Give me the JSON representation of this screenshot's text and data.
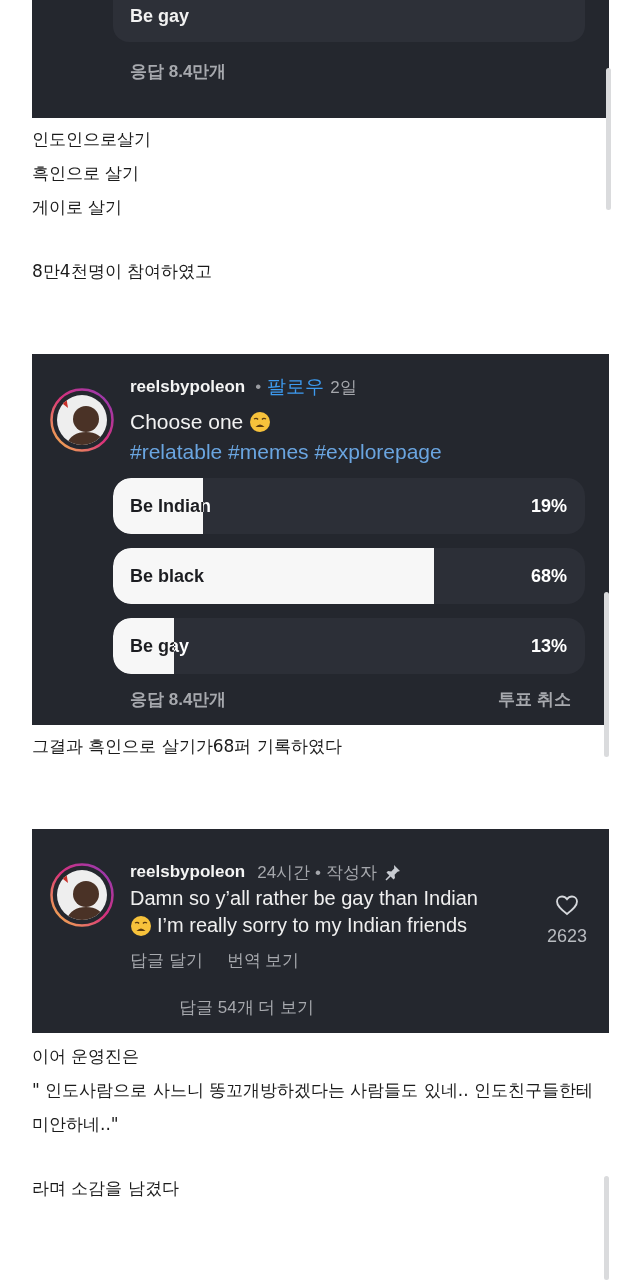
{
  "content": [
    {
      "kind": "poll_tail",
      "option": {
        "label": "Be gay"
      },
      "responses": "응답 8.4만개"
    },
    {
      "kind": "paragraph",
      "lines": [
        "인도인으로살기",
        "흑인으로 살기",
        "게이로 살기"
      ]
    },
    {
      "kind": "paragraph",
      "lines": [
        "8만4천명이 참여하였고"
      ]
    },
    {
      "kind": "poll",
      "username": "reelsbypoleon",
      "separator": "•",
      "follow": "팔로우",
      "age": "2일",
      "caption": "Choose one",
      "hashtags": "#relatable #memes #explorepage",
      "options": [
        {
          "label": "Be Indian",
          "level": 0.19,
          "percent": "19%"
        },
        {
          "label": "Be black",
          "level": 0.68,
          "percent": "68%"
        },
        {
          "label": "Be gay",
          "level": 0.13,
          "percent": "13%"
        }
      ],
      "responses": "응답 8.4만개",
      "undo": "투표 취소"
    },
    {
      "kind": "paragraph",
      "lines": [
        "그결과 흑인으로 살기가68퍼 기록하였다"
      ]
    },
    {
      "kind": "comment",
      "username": "reelsbypoleon",
      "meta": "24시간 • 작성자",
      "pinned": true,
      "text_line_1": "Damn so y’all rather be gay than Indian",
      "text_line_2": "I’m really sorry to my Indian friends",
      "likes": "2623",
      "reply": "답글 달기",
      "translate": "번역 보기",
      "more_replies": "답글 54개 더 보기"
    },
    {
      "kind": "paragraph",
      "lines": [
        "이어 운영진은",
        "\" 인도사람으로 사느니 똥꼬개방하겠다는 사람들도 있네.. 인도친구들한테 미안하네..\""
      ]
    },
    {
      "kind": "paragraph",
      "lines": [
        "라며 소감을 남겼다"
      ]
    }
  ]
}
